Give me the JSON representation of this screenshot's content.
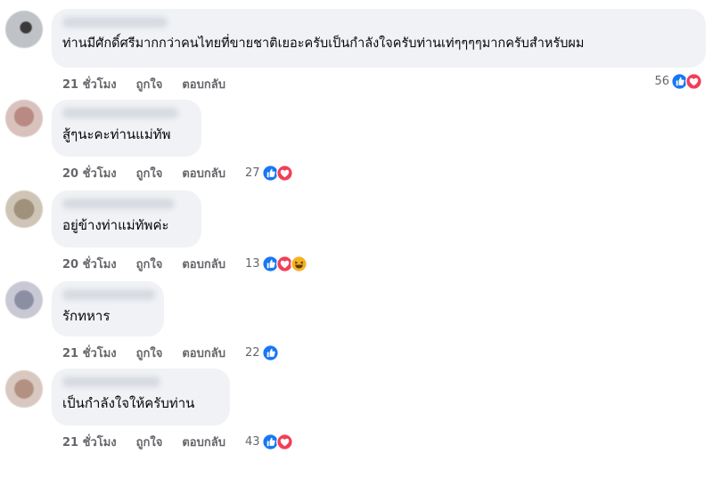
{
  "colors": {
    "like": "#1877f2",
    "love": "#f33e58",
    "haha": "#f7b125",
    "bubble": "#f0f2f5",
    "meta": "#65676b"
  },
  "comments": [
    {
      "text": "ท่านมีศักดิ์ศรีมากกว่าคนไทยที่ขายชาติเยอะครับเป็นกำลังใจครับท่านเท่ๆๆๆๆมากครับสำหรับผม",
      "time": "21 ชั่วโมง",
      "like": "ถูกใจ",
      "reply": "ตอบกลับ",
      "reaction_count": "56",
      "reactions": [
        "like-icon",
        "love-icon"
      ]
    },
    {
      "text": "สู้ๆนะคะท่านแม่ทัพ",
      "time": "20 ชั่วโมง",
      "like": "ถูกใจ",
      "reply": "ตอบกลับ",
      "reaction_count": "27",
      "reactions": [
        "like-icon",
        "love-icon"
      ]
    },
    {
      "text": "อยู่ข้างท่าแม่ทัพค่ะ",
      "time": "20 ชั่วโมง",
      "like": "ถูกใจ",
      "reply": "ตอบกลับ",
      "reaction_count": "13",
      "reactions": [
        "like-icon",
        "love-icon",
        "haha-icon"
      ]
    },
    {
      "text": "รักทหาร",
      "time": "21 ชั่วโมง",
      "like": "ถูกใจ",
      "reply": "ตอบกลับ",
      "reaction_count": "22",
      "reactions": [
        "like-icon"
      ]
    },
    {
      "text": "เป็นกำลังใจให้ครับท่าน",
      "time": "21 ชั่วโมง",
      "like": "ถูกใจ",
      "reply": "ตอบกลับ",
      "reaction_count": "43",
      "reactions": [
        "like-icon",
        "love-icon"
      ]
    }
  ]
}
